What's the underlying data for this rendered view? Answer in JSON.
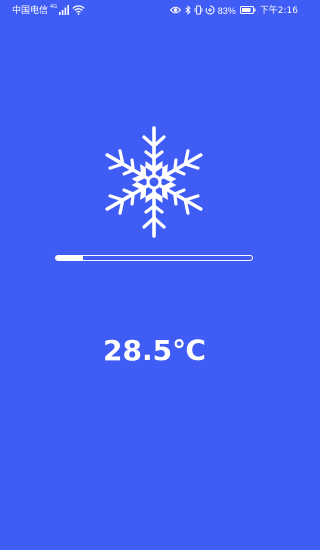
{
  "status_bar": {
    "carrier": "中国电信",
    "network": "4G",
    "battery": "83%",
    "time": "下午2:16",
    "icons": [
      "signal-icon",
      "wifi-icon",
      "eye-icon",
      "bluetooth-icon",
      "vibrate-icon",
      "data-saver-icon",
      "battery-icon"
    ]
  },
  "main": {
    "icon": "snowflake-icon",
    "progress": 0.14,
    "temperature": "28.5℃"
  },
  "colors": {
    "background": "#3f5cf5",
    "foreground": "#ffffff"
  }
}
